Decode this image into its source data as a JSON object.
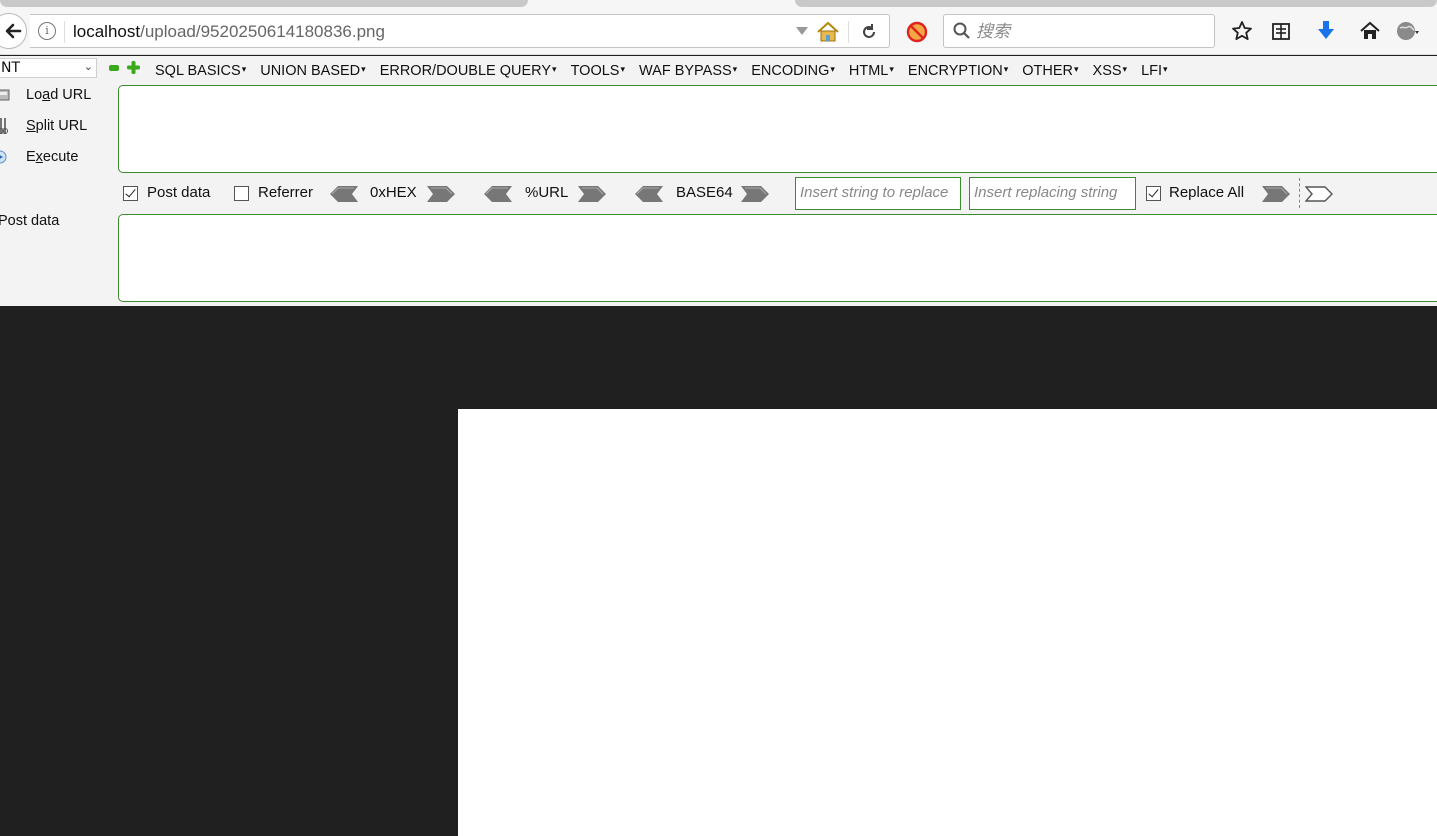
{
  "browser": {
    "url_host": "localhost",
    "url_path": "/upload/9520250614180836.png",
    "search_placeholder": "搜索"
  },
  "hackbar": {
    "selector_value": "NT",
    "menu": [
      "SQL BASICS",
      "UNION BASED",
      "ERROR/DOUBLE QUERY",
      "TOOLS",
      "WAF BYPASS",
      "ENCODING",
      "HTML",
      "ENCRYPTION",
      "OTHER",
      "XSS",
      "LFI"
    ],
    "side_buttons": {
      "load_url": {
        "pre": "Lo",
        "key": "a",
        "post": "d URL"
      },
      "split_url": {
        "pre": "",
        "key": "S",
        "post": "plit URL"
      },
      "execute": {
        "pre": "E",
        "key": "x",
        "post": "ecute"
      }
    },
    "options": {
      "post_data": {
        "label": "Post data",
        "checked": true
      },
      "referrer": {
        "label": "Referrer",
        "checked": false
      },
      "hex_label": "0xHEX",
      "url_label": "%URL",
      "base64_label": "BASE64",
      "replace_placeholder": "Insert string to replace",
      "replacing_placeholder": "Insert replacing string",
      "replace_all": {
        "label": "Replace All",
        "checked": true
      }
    },
    "post_data_label": "Post data",
    "url_value": "",
    "post_value": ""
  },
  "colors": {
    "page_background": "#202020",
    "hackbar_border": "#3d8b2f",
    "download_arrow": "#1a73e8"
  }
}
